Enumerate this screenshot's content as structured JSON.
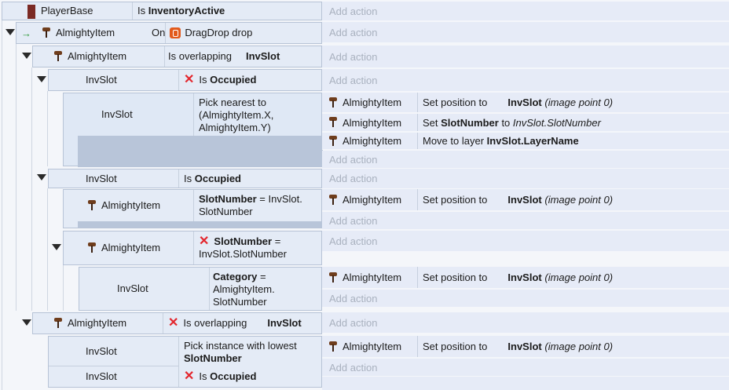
{
  "actions_add_label": "Add action",
  "root": {
    "object": "PlayerBase",
    "cond_prefix": "Is",
    "cond_bold": "InventoryActive",
    "color": "#7b2a24"
  },
  "e1": {
    "object": "AlmightyItem",
    "prefix": "On",
    "text": "DragDrop drop"
  },
  "e2": {
    "object": "AlmightyItem",
    "text": "Is overlapping",
    "target": "InvSlot"
  },
  "e3": {
    "object": "InvSlot",
    "prefix": "Is",
    "bold": "Occupied"
  },
  "e4": {
    "object": "InvSlot",
    "cond_line1": "Pick nearest to",
    "cond_line2": "(AlmightyItem.X,",
    "cond_line3": "AlmightyItem.Y)",
    "actions": [
      {
        "object": "AlmightyItem",
        "text": "Set position to",
        "bold": "InvSlot",
        "italic": "(image point 0)"
      },
      {
        "object": "AlmightyItem",
        "prefix": "Set",
        "bold": "SlotNumber",
        "mid": "to",
        "italic": "InvSlot.SlotNumber"
      },
      {
        "object": "AlmightyItem",
        "text": "Move to layer",
        "bold": "InvSlot.LayerName"
      }
    ]
  },
  "e5": {
    "object": "InvSlot",
    "prefix": "Is",
    "bold": "Occupied"
  },
  "e6": {
    "object": "AlmightyItem",
    "bold": "SlotNumber",
    "rest1": "= InvSlot.",
    "rest2": "SlotNumber",
    "action": {
      "object": "AlmightyItem",
      "text": "Set position to",
      "bold": "InvSlot",
      "italic": "(image point 0)"
    }
  },
  "e7": {
    "object": "AlmightyItem",
    "bold": "SlotNumber",
    "rest1": "=",
    "rest2": "InvSlot.SlotNumber"
  },
  "e8": {
    "object": "InvSlot",
    "bold": "Category",
    "rest1": "=",
    "rest2": "AlmightyItem.",
    "rest3": "SlotNumber",
    "action": {
      "object": "AlmightyItem",
      "text": "Set position to",
      "bold": "InvSlot",
      "italic": "(image point 0)"
    }
  },
  "e9": {
    "object": "AlmightyItem",
    "text": "Is overlapping",
    "target": "InvSlot"
  },
  "e10": {
    "object1": "InvSlot",
    "cond1_line1": "Pick instance with lowest",
    "cond1_bold": "SlotNumber",
    "object2": "InvSlot",
    "cond2_prefix": "Is",
    "cond2_bold": "Occupied",
    "action": {
      "object": "AlmightyItem",
      "text": "Set position to",
      "bold": "InvSlot",
      "italic": "(image point 0)"
    }
  }
}
